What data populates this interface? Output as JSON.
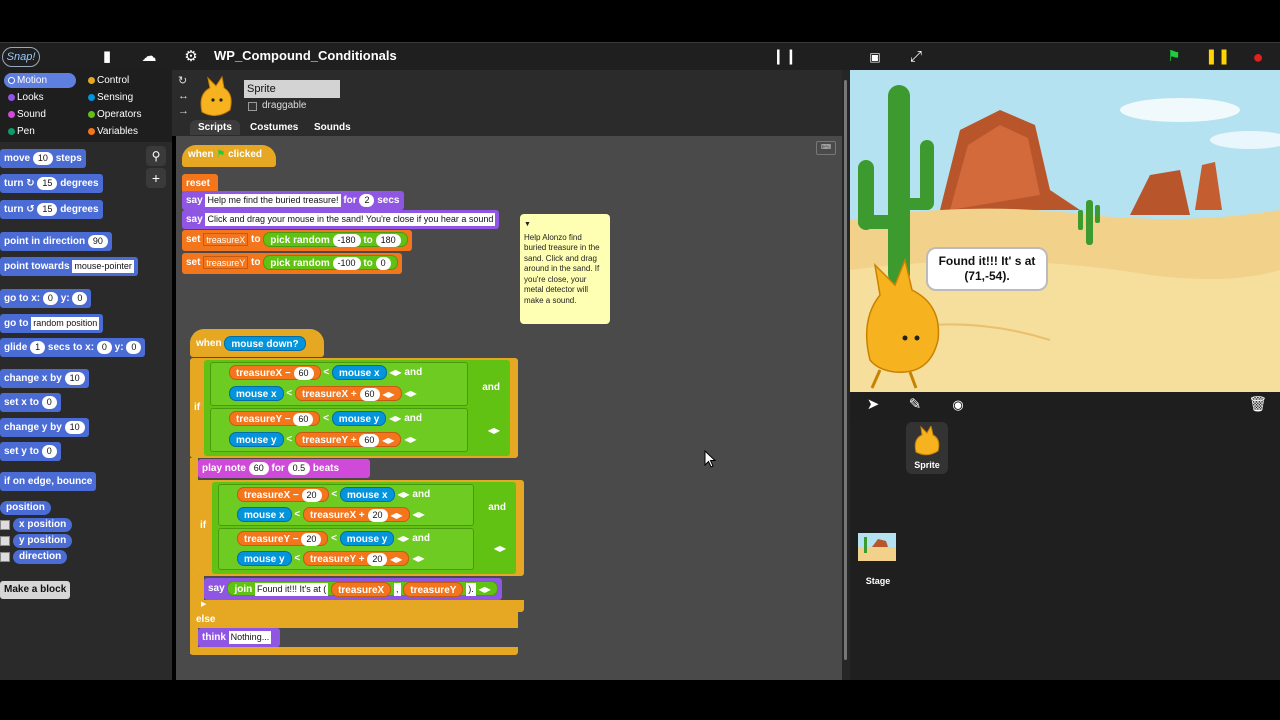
{
  "app": {
    "logo": "Snap!",
    "project_title": "WP_Compound_Conditionals"
  },
  "categories": [
    {
      "label": "Motion",
      "color": "#4a6cd4",
      "selected": true
    },
    {
      "label": "Looks",
      "color": "#8f56e3"
    },
    {
      "label": "Sound",
      "color": "#cf4ad9"
    },
    {
      "label": "Pen",
      "color": "#0e9a6c"
    },
    {
      "label": "Control",
      "color": "#e6a822"
    },
    {
      "label": "Sensing",
      "color": "#0494dc"
    },
    {
      "label": "Operators",
      "color": "#62c213"
    },
    {
      "label": "Variables",
      "color": "#f3761d"
    }
  ],
  "palette": {
    "move": "move",
    "move_val": "10",
    "steps": "steps",
    "turn": "turn",
    "turn_val": "15",
    "degrees": "degrees",
    "point_dir": "point in direction",
    "point_dir_val": "90",
    "point_towards": "point towards",
    "point_towards_val": "mouse-pointer",
    "goto_xy": "go to x:",
    "goto_x": "0",
    "y_label": "y:",
    "goto_y": "0",
    "goto": "go to",
    "goto_val": "random position",
    "glide": "glide",
    "glide_secs": "1",
    "glide_mid": "secs to x:",
    "glide_x": "0",
    "glide_y": "0",
    "change_x": "change x by",
    "change_x_val": "10",
    "set_x": "set x to",
    "set_x_val": "0",
    "change_y": "change y by",
    "change_y_val": "10",
    "set_y": "set y to",
    "set_y_val": "0",
    "bounce": "if on edge, bounce",
    "position": "position",
    "x_position": "x position",
    "y_position": "y position",
    "direction": "direction",
    "make_block": "Make a block"
  },
  "sprite": {
    "name": "Sprite",
    "draggable": "draggable"
  },
  "tabs": [
    "Scripts",
    "Costumes",
    "Sounds"
  ],
  "script1": {
    "when": "when",
    "clicked": "clicked",
    "reset": "reset",
    "say": "say",
    "say1_text": "Help me find the buried treasure!",
    "for": "for",
    "secs_val": "2",
    "secs": "secs",
    "say2_text": "Click and drag your mouse in the sand! You're close if you hear a sound",
    "set": "set",
    "var_x": "treasureX",
    "to": "to",
    "pick_random": "pick random",
    "rx_from": "-180",
    "rx_to": "180",
    "var_y": "treasureY",
    "ry_from": "-100",
    "ry_to": "0"
  },
  "comment": "Help Alonzo find buried treasure in the sand. Click and drag around in the sand. If you're close, your metal detector will make a sound.",
  "script2": {
    "when": "when",
    "mouse_down": "mouse down?",
    "if": "if",
    "and": "and",
    "minus": "−",
    "plus": "+",
    "lt": "<",
    "mouse_x": "mouse x",
    "mouse_y": "mouse y",
    "treasureX": "treasureX",
    "treasureY": "treasureY",
    "n60": "60",
    "n20": "20",
    "play_note": "play note",
    "note_val": "60",
    "beats_for": "for",
    "beats_val": "0.5",
    "beats": "beats",
    "say": "say",
    "join": "join",
    "join_text": "Found it!!! It's at (",
    "comma": ",",
    "close": ").",
    "else": "else",
    "think": "think",
    "think_text": "Nothing..."
  },
  "stage": {
    "bubble": "Found it!!! It' s at (71,-54)."
  },
  "corral": {
    "sprite_label": "Sprite",
    "stage_label": "Stage"
  }
}
